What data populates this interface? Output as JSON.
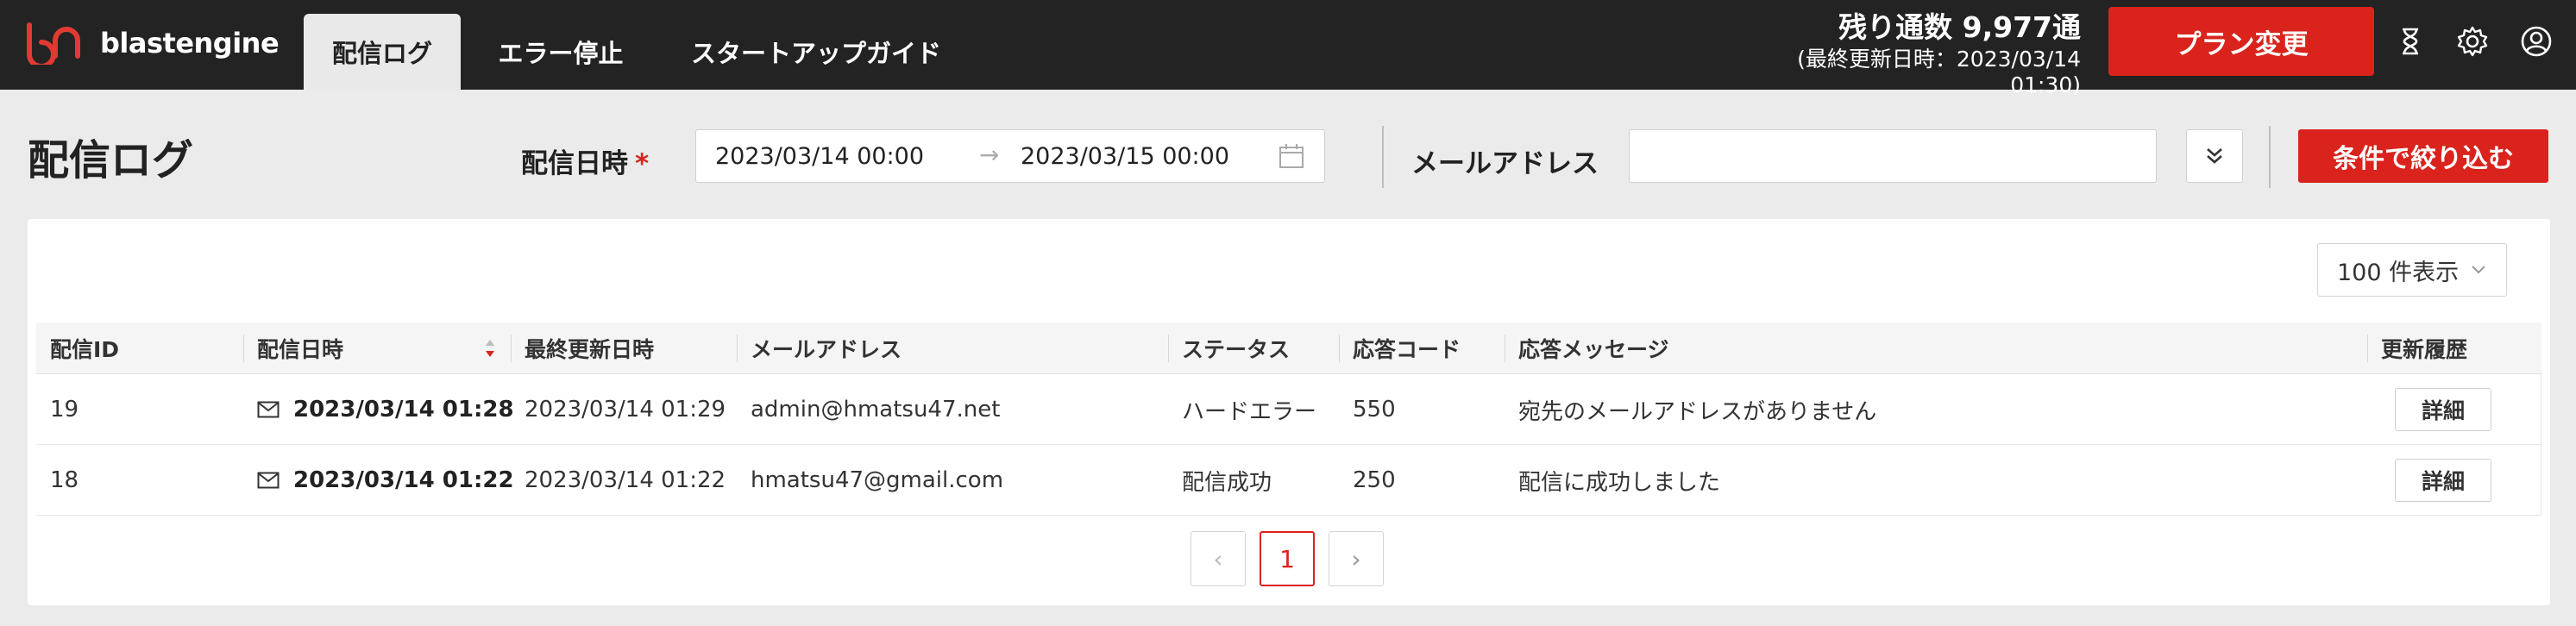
{
  "app": {
    "brand": "blastengine",
    "tabs": [
      {
        "label": "配信ログ",
        "active": true
      },
      {
        "label": "エラー停止",
        "active": false
      },
      {
        "label": "スタートアップガイド",
        "active": false
      }
    ],
    "remaining_label": "残り通数 9,977通",
    "last_updated": "(最終更新日時：2023/03/14 01:30)",
    "plan_button": "プラン変更",
    "icons": [
      "hourglass-icon",
      "gear-icon",
      "user-icon"
    ],
    "accent_color": "#d9231c"
  },
  "filter": {
    "page_title": "配信ログ",
    "date_label": "配信日時",
    "required_mark": "*",
    "date_from": "2023/03/14 00:00",
    "date_to": "2023/03/15 00:00",
    "email_label": "メールアドレス",
    "email_value": "",
    "submit_button": "条件で絞り込む"
  },
  "table": {
    "per_page": "100 件表示",
    "columns": [
      "配信ID",
      "配信日時",
      "最終更新日時",
      "メールアドレス",
      "ステータス",
      "応答コード",
      "応答メッセージ",
      "更新履歴"
    ],
    "rows": [
      {
        "id": "19",
        "sent_at": "2023/03/14 01:28",
        "updated_at": "2023/03/14 01:29",
        "email": "admin@hmatsu47.net",
        "status": "ハードエラー",
        "code": "550",
        "message": "宛先のメールアドレスがありません",
        "action": "詳細"
      },
      {
        "id": "18",
        "sent_at": "2023/03/14 01:22",
        "updated_at": "2023/03/14 01:22",
        "email": "hmatsu47@gmail.com",
        "status": "配信成功",
        "code": "250",
        "message": "配信に成功しました",
        "action": "詳細"
      }
    ]
  },
  "pagination": {
    "current": "1",
    "prev_symbol": "‹",
    "next_symbol": "›"
  }
}
